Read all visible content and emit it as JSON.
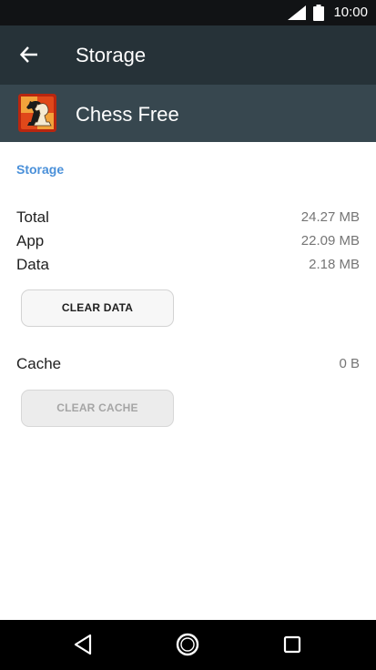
{
  "status_bar": {
    "time": "10:00",
    "icons": [
      "signal-icon",
      "battery-icon"
    ]
  },
  "toolbar": {
    "title": "Storage",
    "back_icon": "arrow-back-icon"
  },
  "app": {
    "name": "Chess Free",
    "icon": "chess-knight-app-icon"
  },
  "storage": {
    "section_title": "Storage",
    "rows": [
      {
        "label": "Total",
        "value": "24.27 MB"
      },
      {
        "label": "App",
        "value": "22.09 MB"
      },
      {
        "label": "Data",
        "value": "2.18 MB"
      }
    ],
    "clear_data_label": "CLEAR DATA"
  },
  "cache": {
    "label": "Cache",
    "value": "0 B",
    "clear_cache_label": "CLEAR CACHE",
    "clear_cache_enabled": false
  },
  "nav_bar": {
    "icons": [
      "back-triangle-icon",
      "home-circle-icon",
      "recents-square-icon"
    ]
  },
  "colors": {
    "status_bar": "#111315",
    "toolbar": "#263238",
    "app_header": "#37474f",
    "accent": "#4a90d9",
    "nav_bar": "#000000"
  }
}
